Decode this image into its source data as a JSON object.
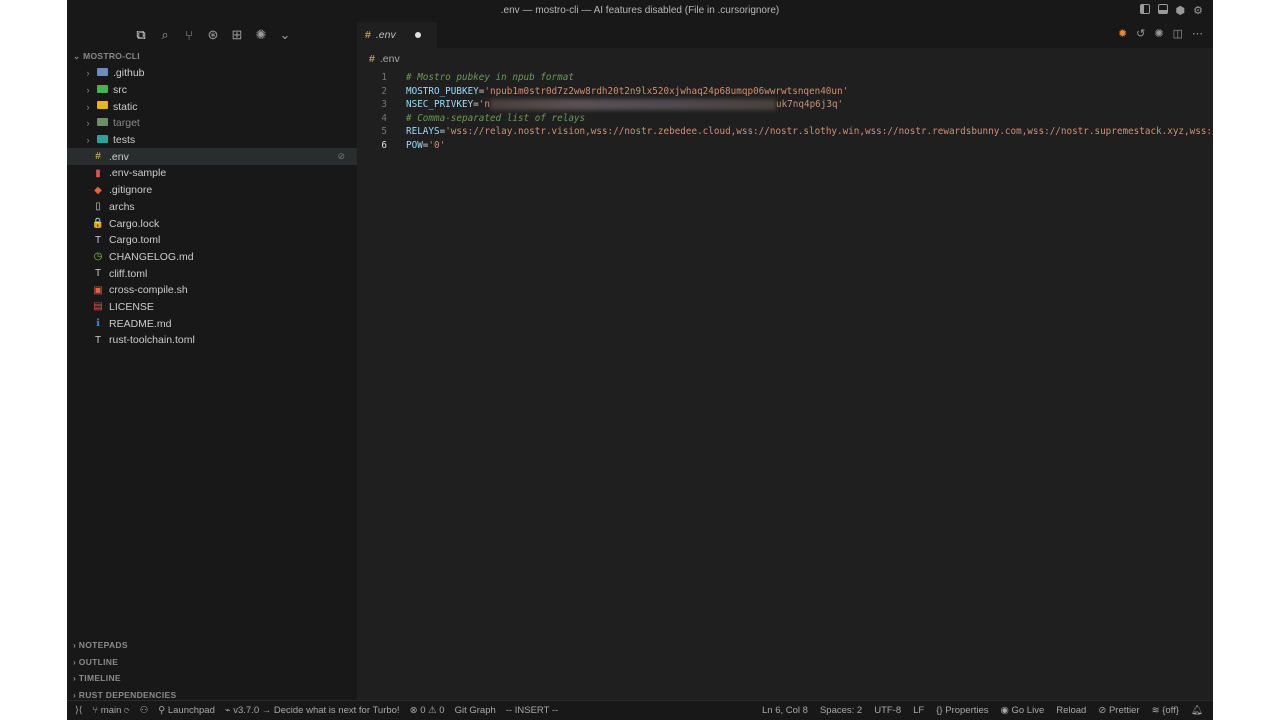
{
  "window": {
    "title": ".env — mostro-cli — AI features disabled (File in .cursorignore)"
  },
  "explorer": {
    "root_label": "MOSTRO-CLI",
    "items": [
      {
        "name": ".github",
        "kind": "folder",
        "color": "#6c8ebf"
      },
      {
        "name": "src",
        "kind": "folder",
        "color": "#4caf50"
      },
      {
        "name": "static",
        "kind": "folder",
        "color": "#e6b422"
      },
      {
        "name": "target",
        "kind": "folder",
        "color": "#6b8e6b"
      },
      {
        "name": "tests",
        "kind": "folder",
        "color": "#26a69a"
      },
      {
        "name": ".env",
        "kind": "file",
        "icon": "#",
        "color": "#e0c068"
      },
      {
        "name": ".env-sample",
        "kind": "file",
        "icon": "▮",
        "color": "#e05252"
      },
      {
        "name": ".gitignore",
        "kind": "file",
        "icon": "◆",
        "color": "#e8643c"
      },
      {
        "name": "archs",
        "kind": "file",
        "icon": "▯",
        "color": "#cccccc"
      },
      {
        "name": "Cargo.lock",
        "kind": "file",
        "icon": "🔒",
        "color": "#e6b422"
      },
      {
        "name": "Cargo.toml",
        "kind": "file",
        "icon": "T",
        "color": "#cccccc"
      },
      {
        "name": "CHANGELOG.md",
        "kind": "file",
        "icon": "◷",
        "color": "#8bc34a"
      },
      {
        "name": "cliff.toml",
        "kind": "file",
        "icon": "T",
        "color": "#cccccc"
      },
      {
        "name": "cross-compile.sh",
        "kind": "file",
        "icon": "▣",
        "color": "#e8643c"
      },
      {
        "name": "LICENSE",
        "kind": "file",
        "icon": "▤",
        "color": "#e05252"
      },
      {
        "name": "README.md",
        "kind": "file",
        "icon": "ℹ",
        "color": "#2196f3"
      },
      {
        "name": "rust-toolchain.toml",
        "kind": "file",
        "icon": "T",
        "color": "#cccccc"
      }
    ],
    "bottom_sections": [
      "NOTEPADS",
      "OUTLINE",
      "TIMELINE",
      "RUST DEPENDENCIES"
    ]
  },
  "tab": {
    "label": ".env"
  },
  "breadcrumb": {
    "label": ".env"
  },
  "editor": {
    "lines": [
      {
        "n": "1",
        "comment": "# Mostro pubkey in npub format"
      },
      {
        "n": "2",
        "key": " MOSTRO_PUBKEY",
        "eq": "=",
        "value": "'npub1m0str0d7z2ww8rdh20t2n9lx520xjwhaq24p68umqp06wwrwtsnqen40un'"
      },
      {
        "n": "3",
        "key": " NSEC_PRIVKEY",
        "eq": "=",
        "value_start": "'n",
        "value_end": "uk7nq4p6j3q'"
      },
      {
        "n": "4",
        "comment": "# Comma-separated list of relays"
      },
      {
        "n": "5",
        "key": "RELAYS",
        "eq": "=",
        "value": "'wss://relay.nostr.vision,wss://nostr.zebedee.cloud,wss://nostr.slothy.win,wss://nostr.rewardsbunny.com,wss://nostr.supremestack.xyz,wss://n"
      },
      {
        "n": "6",
        "key": "POW",
        "eq": "=",
        "value": "'0'"
      }
    ]
  },
  "status": {
    "branch": "main",
    "launchpad": "Launchpad",
    "version_msg": "v3.7.0 → Decide what is next for Turbo!",
    "errors": "0",
    "warnings": "0",
    "git_graph": "Git Graph",
    "mode": "-- INSERT --",
    "position": "Ln 6, Col 8",
    "spaces": "Spaces: 2",
    "encoding": "UTF-8",
    "eol": "LF",
    "properties": "Properties",
    "go_live": "Go Live",
    "reload": "Reload",
    "prettier": "Prettier",
    "off": "{off}"
  }
}
